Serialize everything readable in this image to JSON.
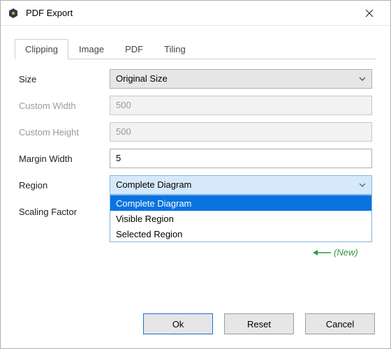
{
  "window": {
    "title": "PDF Export"
  },
  "tabs": [
    {
      "label": "Clipping",
      "active": true
    },
    {
      "label": "Image",
      "active": false
    },
    {
      "label": "PDF",
      "active": false
    },
    {
      "label": "Tiling",
      "active": false
    }
  ],
  "form": {
    "size": {
      "label": "Size",
      "value": "Original Size"
    },
    "custom_width": {
      "label": "Custom Width",
      "value": "500",
      "enabled": false
    },
    "custom_height": {
      "label": "Custom Height",
      "value": "500",
      "enabled": false
    },
    "margin_width": {
      "label": "Margin Width",
      "value": "5",
      "enabled": true
    },
    "region": {
      "label": "Region",
      "value": "Complete Diagram",
      "open": true,
      "options": [
        "Complete Diagram",
        "Visible Region",
        "Selected Region"
      ],
      "highlighted_index": 0
    },
    "scaling_factor": {
      "label": "Scaling Factor"
    }
  },
  "annotation": {
    "text": "(New)"
  },
  "buttons": {
    "ok": "Ok",
    "reset": "Reset",
    "cancel": "Cancel"
  }
}
